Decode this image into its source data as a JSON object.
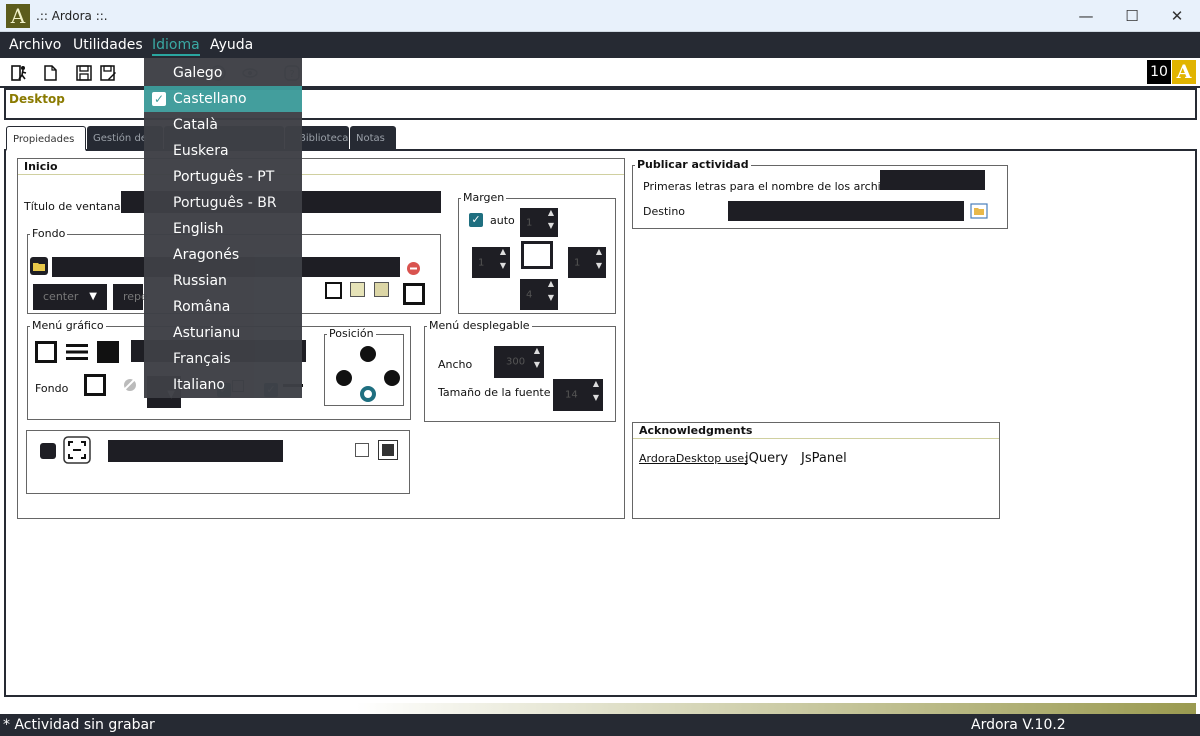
{
  "window": {
    "title": ".:: Ardora ::.",
    "minimize": "—",
    "maximize": "☐",
    "close": "✕",
    "logo_letter": "A"
  },
  "menubar": [
    "Archivo",
    "Utilidades",
    "Idioma",
    "Ayuda"
  ],
  "toolbar": {
    "badge_number": "10",
    "badge_letter": "A"
  },
  "project": {
    "name": "Desktop"
  },
  "tabs": [
    "Propiedades",
    "Gestión de",
    "",
    "Biblioteca",
    "Notas"
  ],
  "inicio": {
    "title": "Inicio",
    "window_title_label": "Título de ventana:",
    "fondo": {
      "legend": "Fondo",
      "align_select": "center",
      "repeat_select": "repe"
    },
    "margen": {
      "legend": "Margen",
      "auto_label": "auto",
      "top": "1",
      "left": "1",
      "right": "1",
      "bottom": "4"
    },
    "menu_grafico": {
      "legend": "Menú gráfico",
      "fondo_label": "Fondo"
    },
    "posicion": {
      "legend": "Posición"
    },
    "menu_desplegable": {
      "legend": "Menú desplegable",
      "ancho_label": "Ancho",
      "ancho_value": "300",
      "font_size_label": "Tamaño de la fuente",
      "font_size_value": "14"
    }
  },
  "publicar": {
    "title": "Publicar actividad",
    "filename_label": "Primeras letras para el nombre de los archivos:",
    "destino_label": "Destino"
  },
  "acknowledgments": {
    "title": "Acknowledgments",
    "uses_label": "ArdoraDesktop use:",
    "libs": [
      "jQuery",
      "JsPanel"
    ]
  },
  "language_menu": {
    "items": [
      "Galego",
      "Castellano",
      "Català",
      "Euskera",
      "Português - PT",
      "Português - BR",
      "English",
      "Aragonés",
      "Russian",
      "Româna",
      "Asturianu",
      "Français",
      "Italiano"
    ],
    "selected": "Castellano"
  },
  "status": {
    "left": "* Actividad sin grabar",
    "right": "Ardora V.10.2"
  },
  "colors": {
    "accent": "#3d9b9a",
    "dark": "#262a33",
    "project_name": "#8a7a00"
  }
}
